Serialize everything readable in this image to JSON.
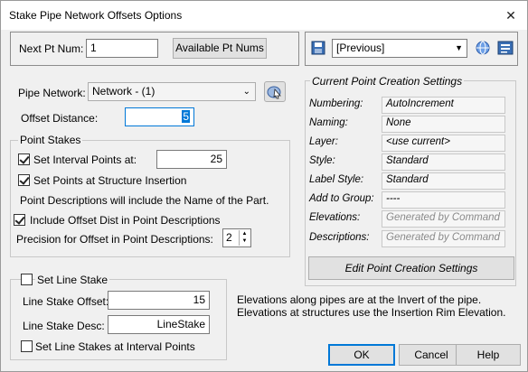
{
  "window": {
    "title": "Stake Pipe Network Offsets Options",
    "close_glyph": "✕"
  },
  "next_pt": {
    "label": "Next Pt Num:",
    "value": "1",
    "available_btn": "Available Pt Nums"
  },
  "style_bar": {
    "selected": "[Previous]"
  },
  "pipe_network": {
    "label": "Pipe Network:",
    "value": "Network - (1)"
  },
  "offset_distance": {
    "label": "Offset Distance:",
    "value": "5"
  },
  "point_stakes": {
    "title": "Point Stakes",
    "interval_label": "Set Interval Points at:",
    "interval_value": "25",
    "structure_label": "Set Points at Structure Insertion",
    "desc_note": "Point Descriptions will include the Name of the Part.",
    "include_offset_label": "Include Offset Dist in Point Descriptions",
    "precision_label": "Precision for Offset in Point Descriptions:",
    "precision_value": "2"
  },
  "line_stake": {
    "title": "Set Line Stake",
    "offset_label": "Line Stake Offset:",
    "offset_value": "15",
    "desc_label": "Line Stake Desc:",
    "desc_value": "LineStake",
    "interval_label": "Set Line Stakes at Interval Points"
  },
  "settings": {
    "title": "Current Point Creation Settings",
    "rows": [
      {
        "label": "Numbering:",
        "value": "AutoIncrement"
      },
      {
        "label": "Naming:",
        "value": "None"
      },
      {
        "label": "Layer:",
        "value": "<use current>"
      },
      {
        "label": "Style:",
        "value": "Standard"
      },
      {
        "label": "Label Style:",
        "value": "Standard"
      },
      {
        "label": "Add to Group:",
        "value": "----"
      },
      {
        "label": "Elevations:",
        "value": "Generated by Command"
      },
      {
        "label": "Descriptions:",
        "value": "Generated by Command"
      }
    ],
    "edit_btn": "Edit Point Creation Settings"
  },
  "note": {
    "line1": "Elevations along pipes are at the Invert of the pipe.",
    "line2": "Elevations at structures use the Insertion Rim Elevation."
  },
  "footer": {
    "ok": "OK",
    "cancel": "Cancel",
    "help": "Help"
  }
}
